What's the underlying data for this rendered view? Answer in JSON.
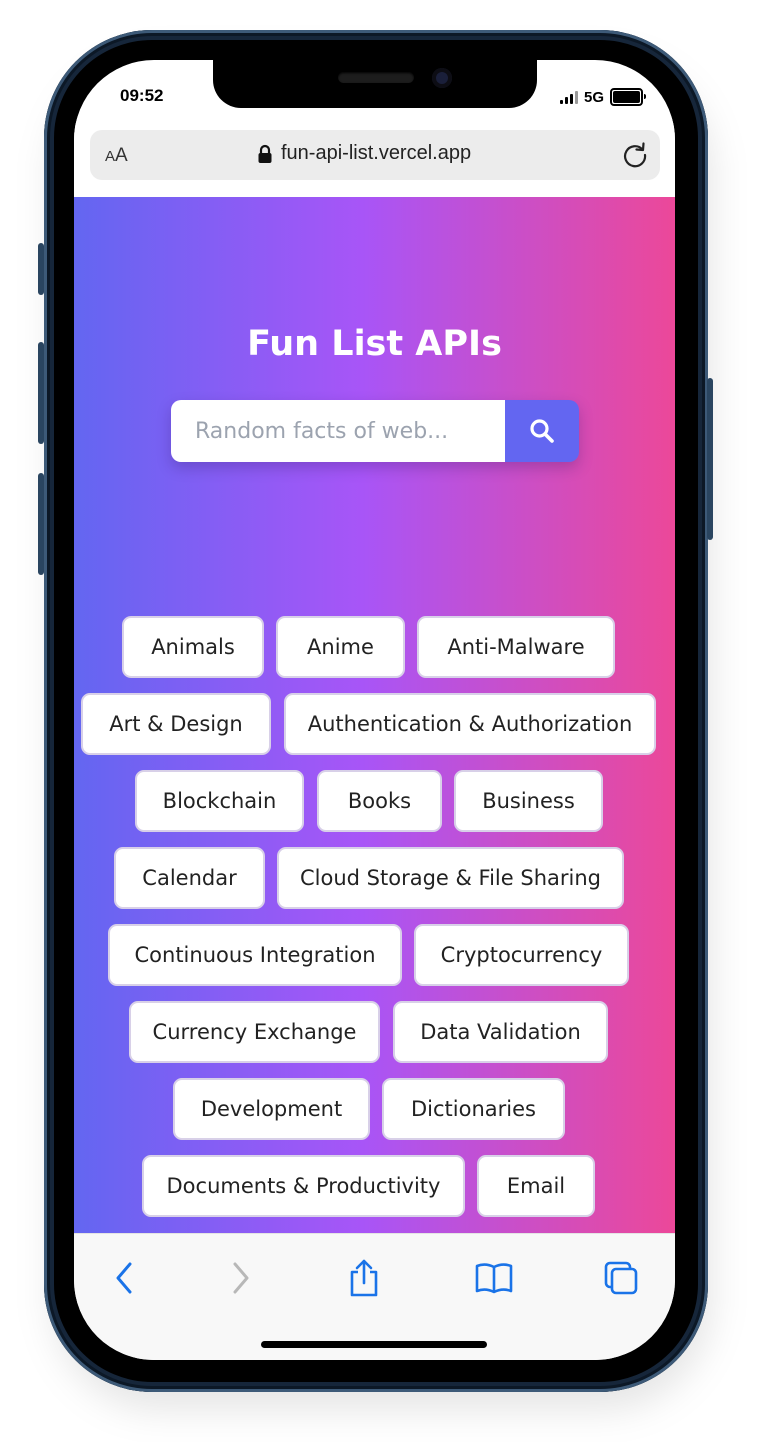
{
  "status": {
    "time": "09:52",
    "network": "5G"
  },
  "browser": {
    "text_size": "AA",
    "url": "fun-api-list.vercel.app"
  },
  "page": {
    "title": "Fun List APIs",
    "search_placeholder": "Random facts of web...",
    "categories": [
      "Animals",
      "Anime",
      "Anti-Malware",
      "Art & Design",
      "Authentication & Authorization",
      "Blockchain",
      "Books",
      "Business",
      "Calendar",
      "Cloud Storage & File Sharing",
      "Continuous Integration",
      "Cryptocurrency",
      "Currency Exchange",
      "Data Validation",
      "Development",
      "Dictionaries",
      "Documents & Productivity",
      "Email"
    ]
  },
  "colors": {
    "gradient_start": "#6366f1",
    "gradient_mid": "#a855f7",
    "gradient_end": "#ec4899",
    "accent": "#6366f1",
    "ios_blue": "#1a73e8"
  },
  "icons": [
    "lock-icon",
    "reload-icon",
    "search-icon",
    "back-icon",
    "forward-icon",
    "share-icon",
    "bookmarks-icon",
    "tabs-icon"
  ]
}
